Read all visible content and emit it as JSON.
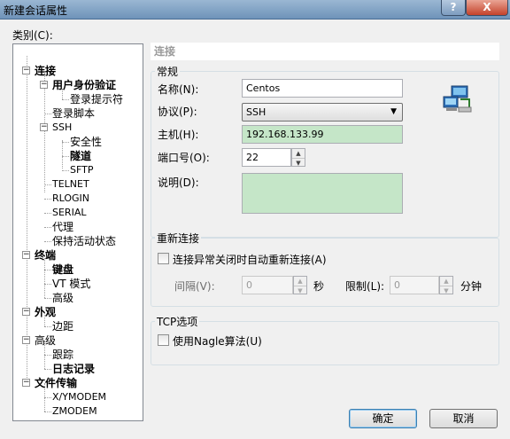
{
  "window": {
    "title": "新建会话属性",
    "help_glyph": "?",
    "close_glyph": "X"
  },
  "category_label": "类别(C):",
  "tree": {
    "expander_open": "−",
    "items": [
      {
        "label": "连接"
      },
      {
        "label": "用户身份验证"
      },
      {
        "label": "登录提示符"
      },
      {
        "label": "登录脚本"
      },
      {
        "label": "SSH"
      },
      {
        "label": "安全性"
      },
      {
        "label": "隧道"
      },
      {
        "label": "SFTP"
      },
      {
        "label": "TELNET"
      },
      {
        "label": "RLOGIN"
      },
      {
        "label": "SERIAL"
      },
      {
        "label": "代理"
      },
      {
        "label": "保持活动状态"
      },
      {
        "label": "终端"
      },
      {
        "label": "键盘"
      },
      {
        "label": "VT 模式"
      },
      {
        "label": "高级"
      },
      {
        "label": "外观"
      },
      {
        "label": "边距"
      },
      {
        "label": "高级"
      },
      {
        "label": "跟踪"
      },
      {
        "label": "日志记录"
      },
      {
        "label": "文件传输"
      },
      {
        "label": "X/YMODEM"
      },
      {
        "label": "ZMODEM"
      }
    ]
  },
  "pane": {
    "header": "连接",
    "general": {
      "title": "常规",
      "name_label": "名称(N):",
      "name_value": "Centos",
      "protocol_label": "协议(P):",
      "protocol_value": "SSH",
      "host_label": "主机(H):",
      "host_value": "192.168.133.99",
      "port_label": "端口号(O):",
      "port_value": "22",
      "desc_label": "说明(D):",
      "desc_value": ""
    },
    "reconnect": {
      "title": "重新连接",
      "checkbox_label": "连接异常关闭时自动重新连接(A)",
      "checked": false,
      "interval_label": "间隔(V):",
      "interval_value": "0",
      "interval_unit": "秒",
      "limit_label": "限制(L):",
      "limit_value": "0",
      "limit_unit": "分钟"
    },
    "tcp": {
      "title": "TCP选项",
      "nagle_label": "使用Nagle算法(U)",
      "checked": false
    }
  },
  "buttons": {
    "ok": "确定",
    "cancel": "取消"
  },
  "colors": {
    "accent_field": "#c5e6c8",
    "titlebar": "#7fa0c4"
  }
}
